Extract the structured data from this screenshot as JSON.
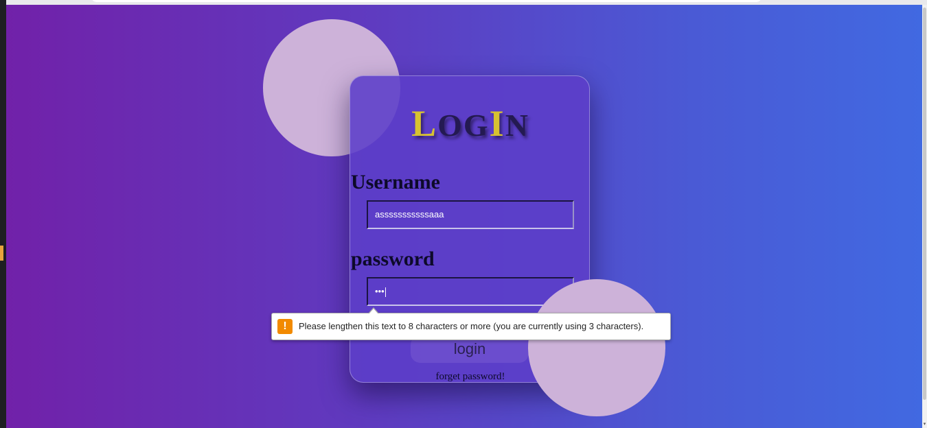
{
  "page": {
    "title_parts": [
      {
        "text": "L",
        "style": "big gold"
      },
      {
        "text": "OG",
        "style": "small dark"
      },
      {
        "text": "I",
        "style": "big gold"
      },
      {
        "text": "N",
        "style": "small dark"
      }
    ],
    "username_label": "Username",
    "username_value": "asssssssssssaaa",
    "password_label": "password",
    "password_value": "•••",
    "login_button": "login",
    "forget_link": "forget password!"
  },
  "validation": {
    "icon": "!",
    "message": "Please lengthen this text to 8 characters or more (you are currently using 3 characters)."
  },
  "colors": {
    "gradient_start": "#7121a9",
    "gradient_end": "#4169e1",
    "title_gold": "#d7c232",
    "title_dark": "#241a52",
    "warning": "#f28a00"
  }
}
